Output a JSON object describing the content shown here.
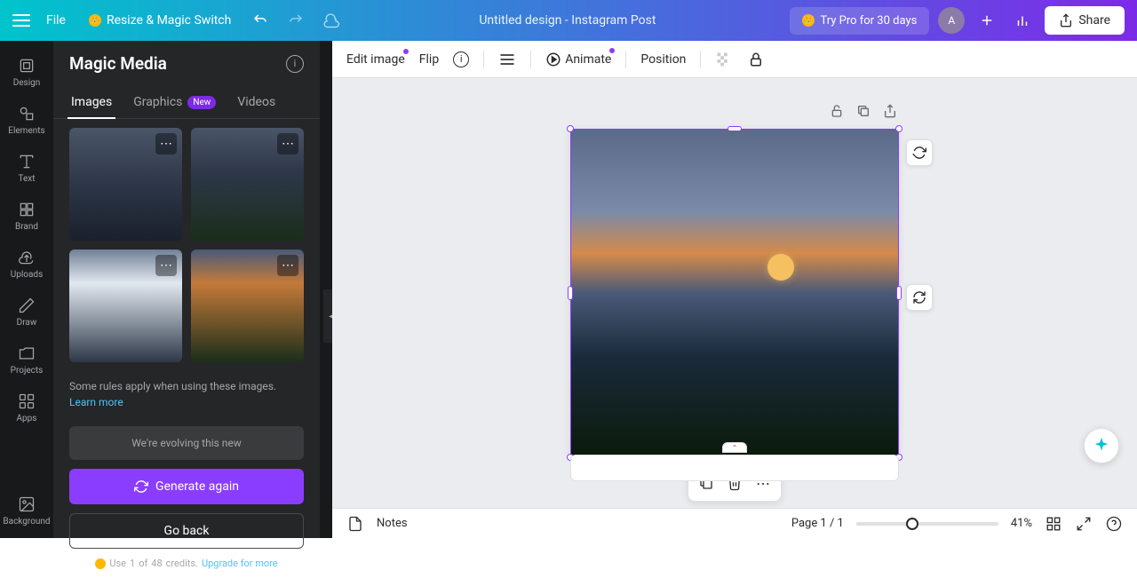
{
  "topbar": {
    "file_label": "File",
    "resize_label": "Resize & Magic Switch",
    "title": "Untitled design - Instagram Post",
    "try_pro_label": "Try Pro for 30 days",
    "share_label": "Share",
    "avatar_initial": "A"
  },
  "nav": {
    "items": [
      {
        "label": "Design",
        "icon": "design"
      },
      {
        "label": "Elements",
        "icon": "elements"
      },
      {
        "label": "Text",
        "icon": "text"
      },
      {
        "label": "Brand",
        "icon": "brand"
      },
      {
        "label": "Uploads",
        "icon": "uploads"
      },
      {
        "label": "Draw",
        "icon": "draw"
      },
      {
        "label": "Projects",
        "icon": "projects"
      },
      {
        "label": "Apps",
        "icon": "apps"
      },
      {
        "label": "Background",
        "icon": "background"
      }
    ]
  },
  "panel": {
    "title": "Magic Media",
    "tabs": {
      "images": "Images",
      "graphics": "Graphics",
      "graphics_badge": "New",
      "videos": "Videos"
    },
    "rules_text": "Some rules apply when using these images. ",
    "rules_link": "Learn more",
    "evolving_text": "We're evolving this new",
    "generate_label": "Generate again",
    "goback_label": "Go back",
    "credits_prefix": "Use ",
    "credits_used": "1",
    "credits_of": " of ",
    "credits_total": "48",
    "credits_suffix": " credits. ",
    "upgrade_link": "Upgrade for more"
  },
  "canvas_toolbar": {
    "edit_image": "Edit image",
    "flip": "Flip",
    "animate": "Animate",
    "position": "Position"
  },
  "bottom": {
    "notes_label": "Notes",
    "page_label": "Page 1 / 1",
    "zoom_label": "41%"
  }
}
